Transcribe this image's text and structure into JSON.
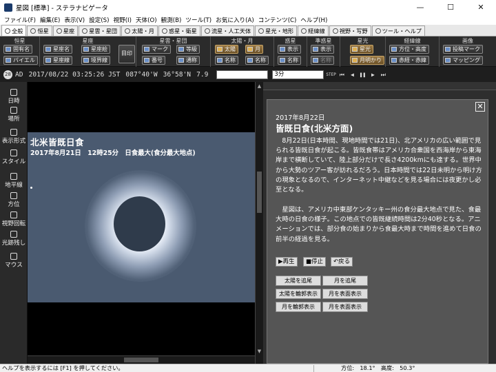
{
  "window": {
    "title": "星図 [標準] - ステラナビゲータ",
    "controls": [
      "—",
      "☐",
      "✕"
    ]
  },
  "menu": [
    "ファイル(F)",
    "編集(E)",
    "表示(V)",
    "設定(S)",
    "視野(I)",
    "天体(O)",
    "観測(B)",
    "ツール(T)",
    "お気に入り(A)",
    "コンテンツ(C)",
    "ヘルプ(H)"
  ],
  "tabs": [
    "全般",
    "恒星",
    "星座",
    "星雲・星団",
    "太陽・月",
    "惑星・衛星",
    "流星・人工天体",
    "星光・地形",
    "経緯線",
    "視野・写野",
    "ツール・ヘルプ"
  ],
  "ribbon": {
    "groups": [
      {
        "label": "恒星",
        "buttons": [
          "固有名",
          "バイエル"
        ]
      },
      {
        "label": "星座",
        "buttons": [
          "星座名",
          "星座線",
          "星座絵",
          "境界線",
          "目印"
        ]
      },
      {
        "label": "星雲・星団",
        "buttons": [
          "マーク",
          "番号",
          "等級",
          "通称"
        ]
      },
      {
        "label": "太陽・月",
        "buttons": [
          "太陽",
          "名称",
          "月",
          "名称"
        ]
      },
      {
        "label": "惑星",
        "buttons": [
          "表示",
          "名称"
        ]
      },
      {
        "label": "準惑星",
        "buttons": [
          "表示",
          "名称"
        ]
      },
      {
        "label": "星光",
        "buttons": [
          "星光",
          "月明かり"
        ]
      },
      {
        "label": "経緯線",
        "buttons": [
          "方位・高度",
          "赤経・赤緯"
        ]
      },
      {
        "label": "画像",
        "buttons": [
          "投稿マーク",
          "マッピング"
        ]
      }
    ]
  },
  "statusrow": {
    "badge": "28",
    "ad": "AD",
    "date": "2017/08/22 03:25:26 JST",
    "lon": "087°40'W",
    "lat": "36°58'N",
    "zoom": "7.9",
    "step": "3分",
    "step_label": "STEP"
  },
  "sidebar": [
    {
      "label": "日時",
      "icon": "clock-icon"
    },
    {
      "label": "場所",
      "icon": "location-icon"
    },
    {
      "label": "表示形式",
      "icon": "display-icon"
    },
    {
      "label": "スタイル",
      "icon": "style-icon"
    },
    {
      "label": "地平線",
      "icon": "horizon-icon"
    },
    {
      "label": "方位",
      "icon": "compass-icon"
    },
    {
      "label": "視野回転",
      "icon": "rotate-icon"
    },
    {
      "label": "光跡残し",
      "icon": "trail-icon"
    },
    {
      "label": "マウス",
      "icon": "mouse-icon"
    }
  ],
  "sky": {
    "title": "北米皆既日食",
    "subtitle": "2017年8月21日　12時25分　日食最大(食分最大地点)"
  },
  "panel": {
    "date": "2017年8月22日",
    "heading": "皆既日食(北米方面)",
    "para1": "　8月22日(日本時間、現地時間では21日)、北アメリカの広い範囲で見られる皆既日食が起こる。皆既食帯はアメリカ合衆国を西海岸から東海岸まで横断していて、陸上部分だけで長さ4200kmにも達する。世界中から大勢のツアー客が訪れるだろう。日本時間では22日未明から明け方の現象となるので、インターネット中継などを見る場合には夜更かし必至となる。",
    "para2": "　星図は、アメリカ中東部ケンタッキー州の食分最大地点で見た、食最大時の日食の様子。この地点での皆既継続時間は2分40秒となる。アニメーションでは、部分食の始まりから食最大時まで時間を進めて日食の前半の経過を見る。",
    "controls": [
      "▶再生",
      "■停止",
      "↶戻る"
    ],
    "actions": [
      "太陽を追尾",
      "月を追尾",
      "太陽を輪郭表示",
      "月を表面表示",
      "月を輪郭表示",
      "月を表面表示"
    ]
  },
  "statusbar": {
    "help": "ヘルプを表示するには [F1] を押してください。",
    "azimuth": "方位:　18.1°　高度:　50.3°"
  }
}
